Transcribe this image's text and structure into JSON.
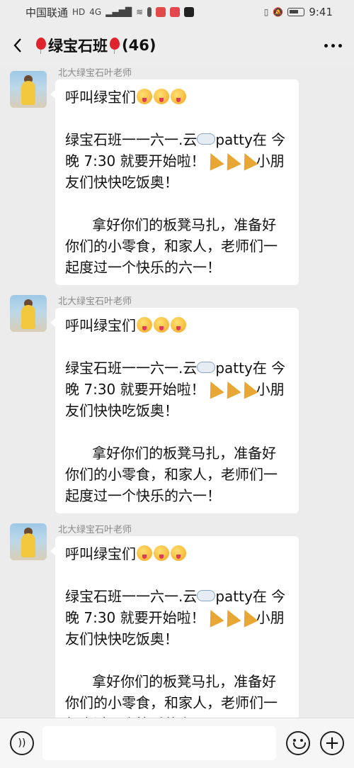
{
  "status_bar": {
    "carrier": "中国联通",
    "hd": "HD",
    "network": "4G",
    "battery": "",
    "time": "9:41"
  },
  "header": {
    "title": "绿宝石班",
    "count": "(46)",
    "back_icon": "chevron-left-icon",
    "more_icon": "more-dots-icon"
  },
  "messages": [
    {
      "sender": "北大绿宝石叶老师",
      "line1": "呼叫绿宝们",
      "line2a": "绿宝石班一一六一.云",
      "line2b": "patty在 今晚 7:30 就要开始啦！",
      "line2c": "小朋友们快快吃饭奥！",
      "line3": "      拿好你们的板凳马扎，准备好你们的小零食，和家人，老师们一起度过一个快乐的六一！"
    },
    {
      "sender": "北大绿宝石叶老师",
      "line1": "呼叫绿宝们",
      "line2a": "绿宝石班一一六一.云",
      "line2b": "patty在 今晚 7:30 就要开始啦！",
      "line2c": "小朋友们快快吃饭奥！",
      "line3": "      拿好你们的板凳马扎，准备好你们的小零食，和家人，老师们一起度过一个快乐的六一！"
    },
    {
      "sender": "北大绿宝石叶老师",
      "line1": "呼叫绿宝们",
      "line2a": "绿宝石班一一六一.云",
      "line2b": "patty在 今晚 7:30 就要开始啦！",
      "line2c": "小朋友们快快吃饭奥！",
      "line3": "      拿好你们的板凳马扎，准备好你们的小零食，和家人，老师们一起度过一个快乐的六一！"
    }
  ],
  "input_bar": {
    "voice_icon": "voice-icon",
    "emoji_icon": "emoji-icon",
    "plus_icon": "plus-icon"
  }
}
